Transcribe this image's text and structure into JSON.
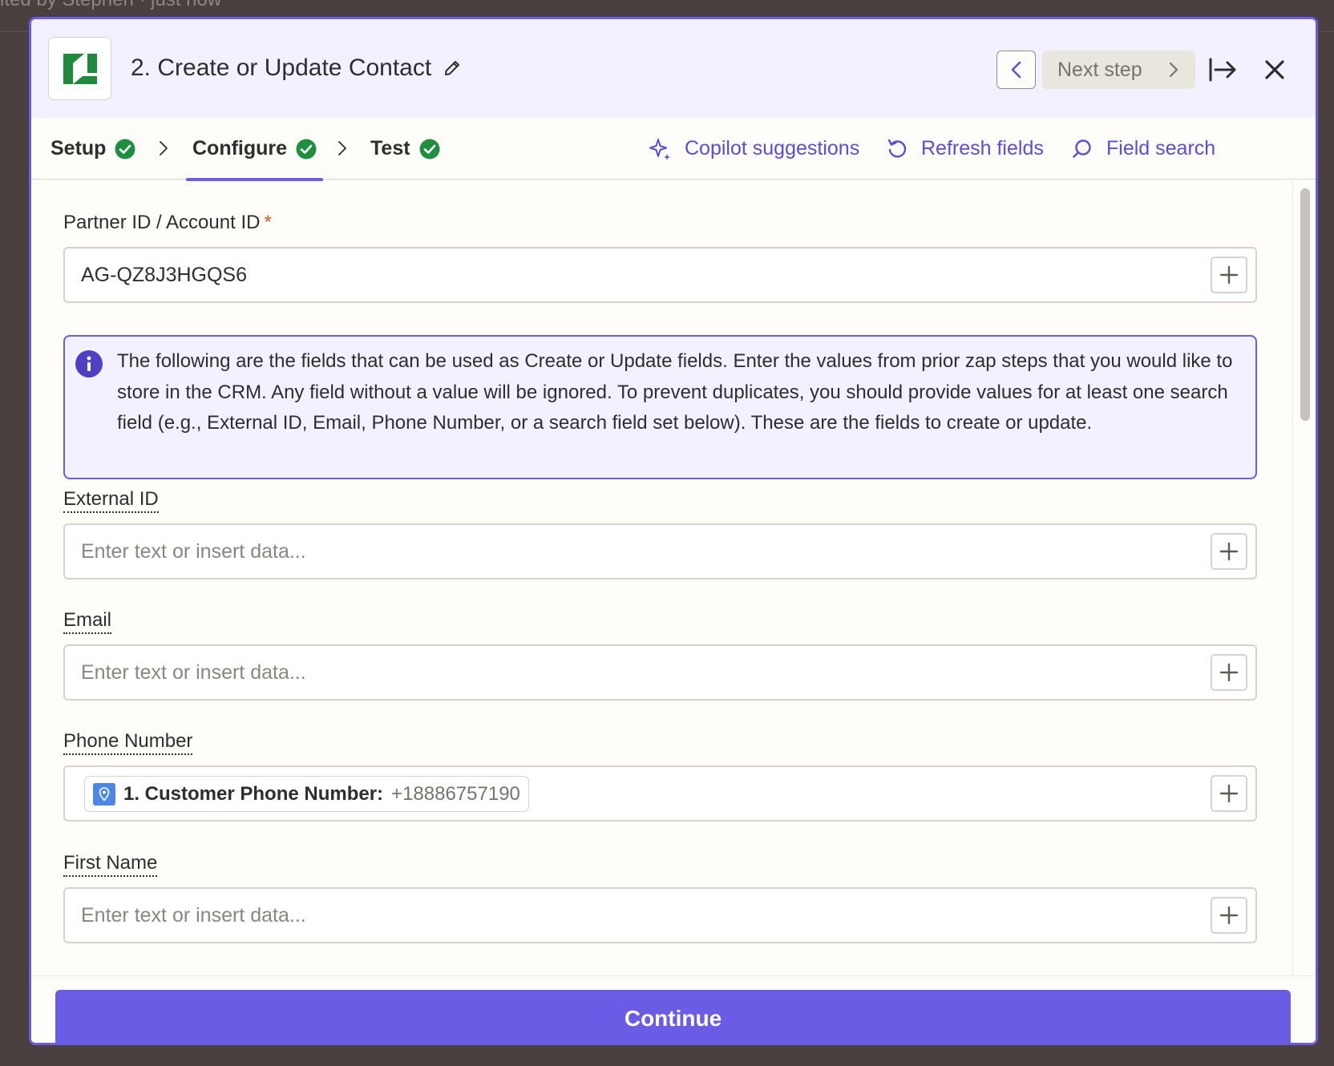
{
  "background": {
    "partial_text": "ited by Stephen · just now"
  },
  "header": {
    "title": "2. Create or Update Contact",
    "next_step_label": "Next step"
  },
  "tabs": [
    {
      "label": "Setup",
      "complete": true
    },
    {
      "label": "Configure",
      "complete": true,
      "active": true
    },
    {
      "label": "Test",
      "complete": true
    }
  ],
  "tools": {
    "copilot": "Copilot suggestions",
    "refresh": "Refresh fields",
    "search": "Field search"
  },
  "fields": {
    "partner": {
      "label": "Partner ID / Account ID",
      "required_mark": "*",
      "value": "AG-QZ8J3HGQS6"
    },
    "info": "The following are the fields that can be used as Create or Update fields. Enter the values from prior zap steps that you would like to store in the CRM. Any field without a value will be ignored. To prevent duplicates, you should provide values for at least one search field (e.g., External ID, Email, Phone Number, or a search field set below). These are the fields to create or update.",
    "external_id": {
      "label": "External ID",
      "placeholder": "Enter text or insert data..."
    },
    "email": {
      "label": "Email",
      "placeholder": "Enter text or insert data..."
    },
    "phone": {
      "label": "Phone Number",
      "pill_label": "1. Customer Phone Number:",
      "pill_value": "+18886757190"
    },
    "first_name": {
      "label": "First Name",
      "placeholder": "Enter text or insert data..."
    }
  },
  "footer": {
    "continue_label": "Continue"
  },
  "colors": {
    "accent": "#6a5ce4",
    "success": "#1e8f3e",
    "required": "#e0561d",
    "logo_green": "#1f8a3c"
  }
}
